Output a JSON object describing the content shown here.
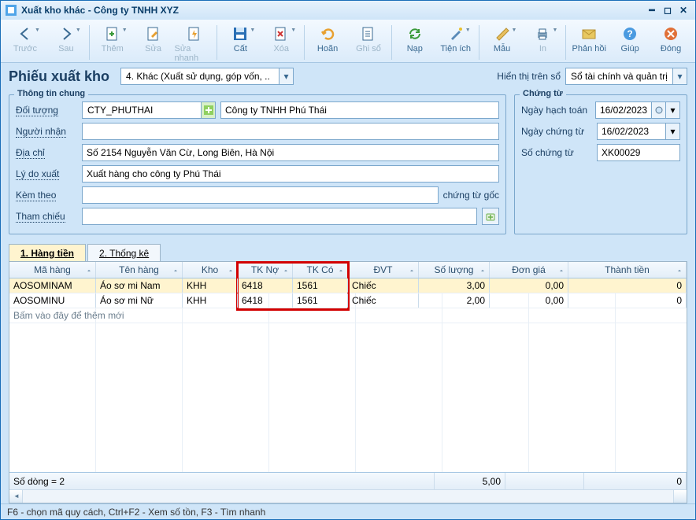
{
  "title": "Xuất kho khác - Công ty TNHH XYZ",
  "toolbar": [
    {
      "name": "back-btn",
      "label": "Trước",
      "icon": "arrow-left",
      "disabled": true,
      "dd": true
    },
    {
      "name": "forward-btn",
      "label": "Sau",
      "icon": "arrow-right",
      "disabled": true,
      "dd": true
    },
    {
      "name": "add-btn",
      "label": "Thêm",
      "icon": "doc-plus",
      "disabled": true,
      "dd": true,
      "sep": true
    },
    {
      "name": "edit-btn",
      "label": "Sửa",
      "icon": "doc-pen",
      "disabled": true
    },
    {
      "name": "quickedit-btn",
      "label": "Sửa nhanh",
      "icon": "doc-flash",
      "disabled": true
    },
    {
      "name": "save-btn",
      "label": "Cất",
      "icon": "floppy",
      "disabled": false,
      "dd": true,
      "sep": true
    },
    {
      "name": "delete-btn",
      "label": "Xóa",
      "icon": "doc-x",
      "disabled": true,
      "dd": true
    },
    {
      "name": "undo-btn",
      "label": "Hoãn",
      "icon": "undo",
      "disabled": false,
      "sep": true
    },
    {
      "name": "post-btn",
      "label": "Ghi sổ",
      "icon": "post",
      "disabled": true
    },
    {
      "name": "load-btn",
      "label": "Nạp",
      "icon": "refresh",
      "disabled": false,
      "sep": true
    },
    {
      "name": "util-btn",
      "label": "Tiện ích",
      "icon": "wand",
      "disabled": false,
      "dd": true
    },
    {
      "name": "template-btn",
      "label": "Mẫu",
      "icon": "ruler",
      "disabled": false,
      "dd": true,
      "sep": true
    },
    {
      "name": "print-btn",
      "label": "In",
      "icon": "printer",
      "disabled": true,
      "dd": true
    },
    {
      "name": "feedback-btn",
      "label": "Phản hồi",
      "icon": "mail",
      "disabled": false,
      "sep": true
    },
    {
      "name": "help-btn",
      "label": "Giúp",
      "icon": "help",
      "disabled": false
    },
    {
      "name": "close-btn",
      "label": "Đóng",
      "icon": "close",
      "disabled": false
    }
  ],
  "header": {
    "title": "Phiếu xuất kho",
    "type_combo": "4. Khác (Xuất sử dụng, góp vốn, ..",
    "display_label": "Hiển thị trên sổ",
    "display_combo": "Sổ tài chính và quản trị"
  },
  "general": {
    "legend": "Thông tin chung",
    "obj_label": "Đối tượng",
    "obj_code": "CTY_PHUTHAI",
    "obj_name": "Công ty TNHH Phú Thái",
    "recv_label": "Người nhận",
    "recv": "",
    "addr_label": "Địa chỉ",
    "addr": "Số 2154 Nguyễn Văn Cừ, Long Biên, Hà Nội",
    "reason_label": "Lý do xuất",
    "reason": "Xuất hàng cho công ty Phú Thái",
    "attach_label": "Kèm theo",
    "attach": "",
    "attach_suffix": "chứng từ gốc",
    "ref_label": "Tham chiếu",
    "ref": ""
  },
  "voucher": {
    "legend": "Chứng từ",
    "date1_label": "Ngày hạch toán",
    "date1": "16/02/2023",
    "date2_label": "Ngày chứng từ",
    "date2": "16/02/2023",
    "no_label": "Số chứng từ",
    "no": "XK00029"
  },
  "tabs": {
    "t1": "1. Hàng tiền",
    "t2": "2. Thống kê"
  },
  "grid": {
    "cols": [
      "Mã hàng",
      "Tên hàng",
      "Kho",
      "TK Nợ",
      "TK Có",
      "ĐVT",
      "Số lượng",
      "Đơn giá",
      "Thành tiền"
    ],
    "rows": [
      {
        "code": "AOSOMINAM",
        "name": "Áo sơ mi Nam",
        "wh": "KHH",
        "dr": "6418",
        "cr": "1561",
        "unit": "Chiếc",
        "qty": "3,00",
        "price": "0,00",
        "amt": "0"
      },
      {
        "code": "AOSOMINU",
        "name": "Áo sơ mi Nữ",
        "wh": "KHH",
        "dr": "6418",
        "cr": "1561",
        "unit": "Chiếc",
        "qty": "2,00",
        "price": "0,00",
        "amt": "0"
      }
    ],
    "new_row_hint": "Bấm vào đây để thêm mới",
    "footer": {
      "rowcount": "Số dòng = 2",
      "qty_total": "5,00",
      "amt_total": "0"
    }
  },
  "statusbar": "F6 - chọn mã quy cách, Ctrl+F2 - Xem số tồn, F3 - Tìm nhanh"
}
